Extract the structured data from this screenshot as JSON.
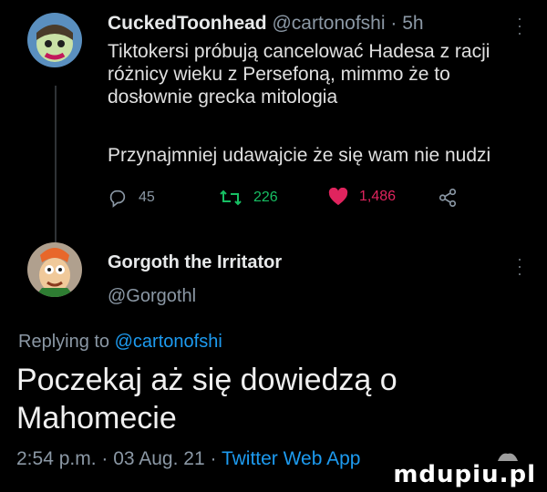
{
  "tweet": {
    "display_name": "CuckedToonhead",
    "handle": "@cartonofshi",
    "separator": "·",
    "time": "5h",
    "text_lines": [
      "Tiktokersi próbują cancelować Hadesa z racji",
      "różnicy wieku z Persefoną, mimmo że to",
      "dosłownie grecka mitologia"
    ],
    "text_line2": "Przynajmniej udawajcie że się wam nie nudzi",
    "actions": {
      "reply_count": "45",
      "retweet_count": "226",
      "like_count": "1,486"
    },
    "colors": {
      "retweet": "#17bf63",
      "like": "#e0245e"
    }
  },
  "reply": {
    "display_name": "Gorgoth the Irritator",
    "handle": "@Gorgothl",
    "replying_prefix": "Replying to",
    "replying_to": "@cartonofshi",
    "text_lines": [
      "Poczekaj aż się dowiedzą o",
      "Mahomecie"
    ],
    "meta_time": "2:54 p.m. · 03 Aug. 21 ·",
    "meta_source": "Twitter Web App"
  },
  "watermark": "mdupiu.pl",
  "icons": [
    "reply-icon",
    "retweet-icon",
    "heart-icon",
    "share-icon",
    "more-icon"
  ]
}
